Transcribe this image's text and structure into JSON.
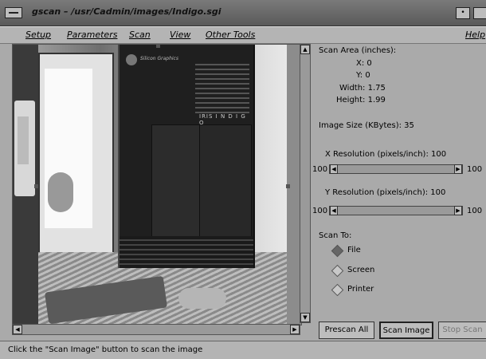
{
  "window": {
    "title": "gscan – /usr/Cadmin/images/Indigo.sgi"
  },
  "menubar": {
    "items": [
      "Setup",
      "Parameters",
      "Scan",
      "View",
      "Other Tools"
    ],
    "help": "Help"
  },
  "image": {
    "logo_text": "Silicon Graphics",
    "brand_text": "IRIS  I N D I G O"
  },
  "panel": {
    "scan_area_title": "Scan Area (inches):",
    "x_label": "X: 0",
    "y_label": "Y: 0",
    "width_label": "Width: 1.75",
    "height_label": "Height: 1.99",
    "image_size": "Image Size (KBytes): 35",
    "x_res_label": "X Resolution (pixels/inch): 100",
    "x_res_min": "100",
    "x_res_max": "100",
    "y_res_label": "Y Resolution (pixels/inch): 100",
    "y_res_min": "100",
    "y_res_max": "100",
    "scan_to_label": "Scan To:",
    "options": [
      "File",
      "Screen",
      "Printer"
    ],
    "selected": "File"
  },
  "buttons": {
    "prescan": "Prescan All",
    "scan": "Scan Image",
    "stop": "Stop Scan"
  },
  "status": {
    "message": "Click the \"Scan Image\" button to scan the image"
  }
}
